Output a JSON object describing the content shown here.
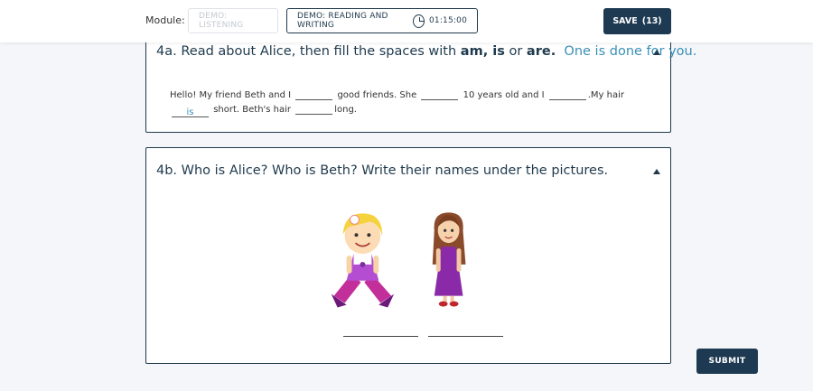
{
  "header": {
    "module_label": "Module:",
    "tabs": [
      {
        "label": "DEMO: LISTENING",
        "state": "inactive"
      },
      {
        "label": "DEMO: READING AND WRITING",
        "state": "active",
        "timer": "01:15:00"
      }
    ],
    "save_label": "SAVE",
    "save_count": "(13)"
  },
  "task_a": {
    "number": "4a.",
    "instruction_prefix": "Read about Alice, then fill the spaces with",
    "word_am_is": "am, is",
    "word_or": "or",
    "word_are": "are.",
    "hint": "One is done for you.",
    "passage": {
      "p1": "Hello! My friend Beth and I",
      "p2": "good friends. She",
      "p3": "10 years old and I",
      "p4": ".My hair",
      "p5": "short.",
      "p6": "Beth's hair",
      "p7": "long.",
      "answers": [
        "",
        "",
        "",
        "is",
        ""
      ]
    }
  },
  "task_b": {
    "title": "4b. Who is Alice? Who is Beth? Write their names under the pictures.",
    "name_inputs": [
      "",
      ""
    ]
  },
  "submit_label": "SUBMIT",
  "colors": {
    "primary": "#1e3a52",
    "hint": "#3a8fb7",
    "background": "#f4f6f9"
  }
}
